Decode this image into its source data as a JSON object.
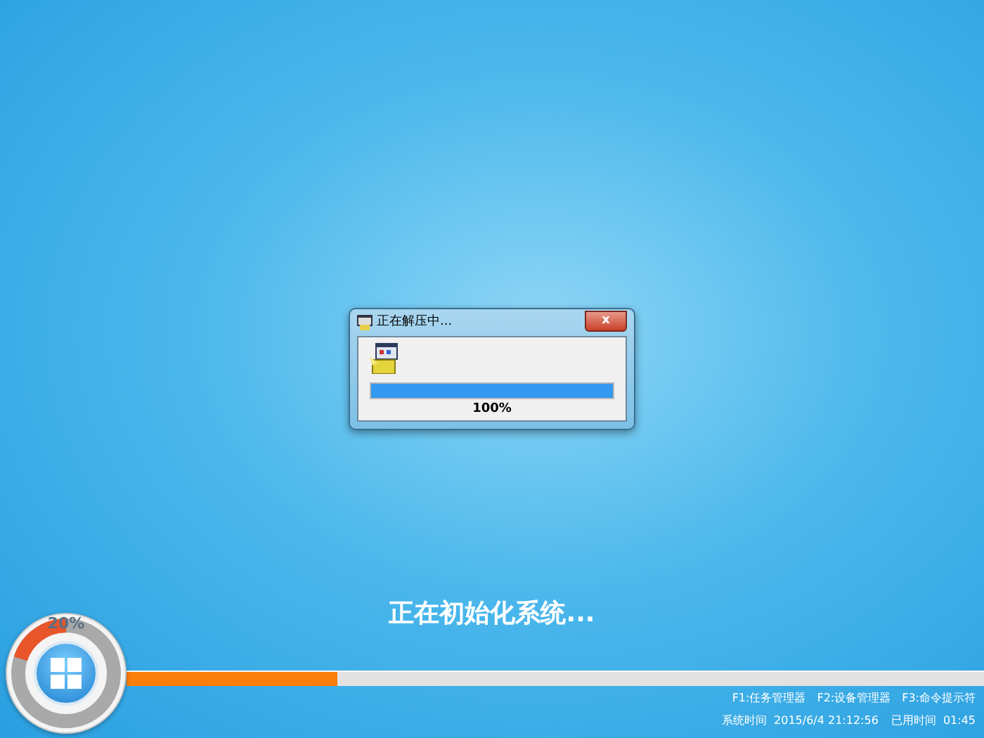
{
  "dialog": {
    "title": "正在解压中...",
    "close": "x",
    "progress": {
      "level": 1.0,
      "reading": "100%"
    }
  },
  "status_text": "正在初始化系统...",
  "gauge": {
    "reading": "20%",
    "level": 0.2
  },
  "main_progress": {
    "level": 0.246
  },
  "hints": [
    "F1:任务管理器",
    "F2:设备管理器",
    "F3:命令提示符"
  ],
  "clock": {
    "system_time_label": "系统时间",
    "system_time": "2015/6/4 21:12:56",
    "elapsed_label": "已用时间",
    "elapsed": "01:45"
  }
}
